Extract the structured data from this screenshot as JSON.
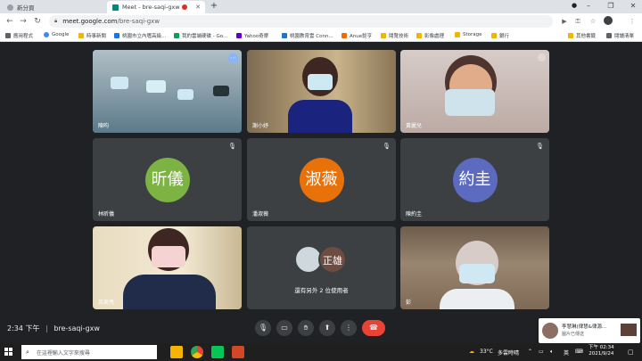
{
  "browser": {
    "tabs": [
      {
        "title": "新分頁",
        "active": false
      },
      {
        "title": "Meet - bre-saqi-gxw",
        "active": true
      }
    ],
    "new_tab_label": "+",
    "url_host": "meet.google.com",
    "url_path": "/bre-saqi-gxw",
    "bookmarks": [
      {
        "label": "應用程式",
        "icon": "apps-icon"
      },
      {
        "label": "Google",
        "icon": "google-icon"
      },
      {
        "label": "時事新聞",
        "icon": "folder-icon"
      },
      {
        "label": "桃園市立內壢高級...",
        "icon": "school-icon"
      },
      {
        "label": "我的雲端硬碟 - Go...",
        "icon": "drive-icon"
      },
      {
        "label": "Yahoo奇摩",
        "icon": "yahoo-icon"
      },
      {
        "label": "桃園教育雲 Conn...",
        "icon": "cloud-icon"
      },
      {
        "label": "Anue鉅亨",
        "icon": "anue-icon"
      },
      {
        "label": "閱覽技術",
        "icon": "folder-icon"
      },
      {
        "label": "影像處理",
        "icon": "folder-icon"
      },
      {
        "label": "Storage",
        "icon": "folder-icon"
      },
      {
        "label": "銀行",
        "icon": "folder-icon"
      }
    ],
    "other_bookmarks": "其他書籤",
    "reading_list": "閱讀清單"
  },
  "meet": {
    "tiles": [
      {
        "name": "陳昀",
        "kind": "video",
        "muted": false
      },
      {
        "name": "謝小妤",
        "kind": "video",
        "muted": false
      },
      {
        "name": "黃麗兒",
        "kind": "video",
        "muted": false
      },
      {
        "name": "林昕儀",
        "kind": "avatar",
        "initials": "昕儀",
        "color": "#7cb342",
        "muted": true
      },
      {
        "name": "潘淑薇",
        "kind": "avatar",
        "initials": "淑薇",
        "color": "#e8710a",
        "muted": true
      },
      {
        "name": "陳約圭",
        "kind": "avatar",
        "initials": "約圭",
        "color": "#5c6bc0",
        "muted": true
      },
      {
        "name": "呂美亮",
        "kind": "video",
        "muted": false
      },
      {
        "name": "還有另外 2 位使用者",
        "kind": "others",
        "initials": "正雄",
        "color": "#6d4c41"
      },
      {
        "name": "彭",
        "kind": "video",
        "muted": false
      }
    ],
    "time": "2:34 下午",
    "separator": "|",
    "meeting_code": "bre-saqi-gxw",
    "toast": {
      "title": "李慧琳(律慧&律源...",
      "subtitle": "圖片已傳送"
    }
  },
  "taskbar": {
    "search_placeholder": "在這裡輸入文字來搜尋",
    "temperature": "33°C",
    "weather": "多雲時晴",
    "ime": "英",
    "time": "下午 02:34",
    "date": "2021/9/24"
  },
  "colors": {
    "meet_bg": "#202124",
    "tile_bg": "#3c4043",
    "end_call": "#ea4335",
    "active_speaker": "#8ab4f8"
  }
}
